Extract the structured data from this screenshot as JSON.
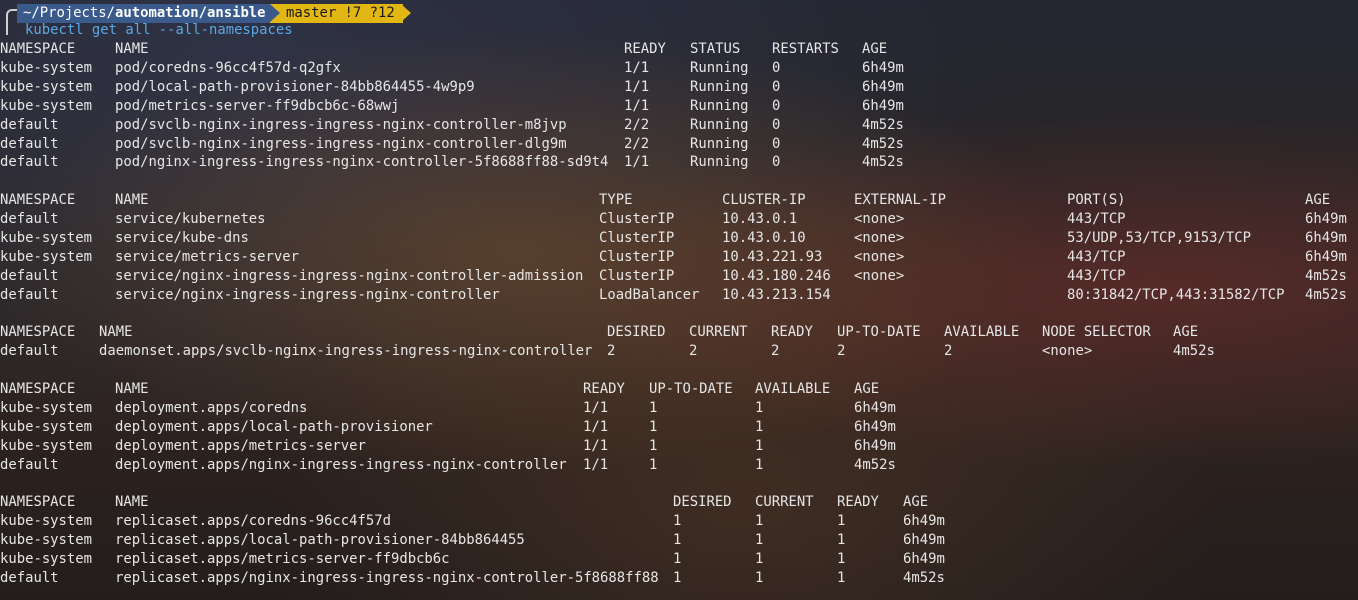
{
  "prompt": {
    "path_prefix": "~/Projects/",
    "path_bold": "automation/ansible",
    "git": "master !7 ?12",
    "command": "kubectl get all --all-namespaces"
  },
  "pods": {
    "headers": [
      "NAMESPACE",
      "NAME",
      "READY",
      "STATUS",
      "RESTARTS",
      "AGE"
    ],
    "rows": [
      [
        "kube-system",
        "pod/coredns-96cc4f57d-q2gfx",
        "1/1",
        "Running",
        "0",
        "6h49m"
      ],
      [
        "kube-system",
        "pod/local-path-provisioner-84bb864455-4w9p9",
        "1/1",
        "Running",
        "0",
        "6h49m"
      ],
      [
        "kube-system",
        "pod/metrics-server-ff9dbcb6c-68wwj",
        "1/1",
        "Running",
        "0",
        "6h49m"
      ],
      [
        "default",
        "pod/svclb-nginx-ingress-ingress-nginx-controller-m8jvp",
        "2/2",
        "Running",
        "0",
        "4m52s"
      ],
      [
        "default",
        "pod/svclb-nginx-ingress-ingress-nginx-controller-dlg9m",
        "2/2",
        "Running",
        "0",
        "4m52s"
      ],
      [
        "default",
        "pod/nginx-ingress-ingress-nginx-controller-5f8688ff88-sd9t4",
        "1/1",
        "Running",
        "0",
        "4m52s"
      ]
    ]
  },
  "services": {
    "headers": [
      "NAMESPACE",
      "NAME",
      "TYPE",
      "CLUSTER-IP",
      "EXTERNAL-IP",
      "PORT(S)",
      "AGE"
    ],
    "rows": [
      [
        "default",
        "service/kubernetes",
        "ClusterIP",
        "10.43.0.1",
        "<none>",
        "443/TCP",
        "6h49m"
      ],
      [
        "kube-system",
        "service/kube-dns",
        "ClusterIP",
        "10.43.0.10",
        "<none>",
        "53/UDP,53/TCP,9153/TCP",
        "6h49m"
      ],
      [
        "kube-system",
        "service/metrics-server",
        "ClusterIP",
        "10.43.221.93",
        "<none>",
        "443/TCP",
        "6h49m"
      ],
      [
        "default",
        "service/nginx-ingress-ingress-nginx-controller-admission",
        "ClusterIP",
        "10.43.180.246",
        "<none>",
        "443/TCP",
        "4m52s"
      ],
      [
        "default",
        "service/nginx-ingress-ingress-nginx-controller",
        "LoadBalancer",
        "10.43.213.154",
        "",
        "80:31842/TCP,443:31582/TCP",
        "4m52s"
      ]
    ]
  },
  "daemonsets": {
    "headers": [
      "NAMESPACE",
      "NAME",
      "DESIRED",
      "CURRENT",
      "READY",
      "UP-TO-DATE",
      "AVAILABLE",
      "NODE SELECTOR",
      "AGE"
    ],
    "rows": [
      [
        "default",
        "daemonset.apps/svclb-nginx-ingress-ingress-nginx-controller",
        "2",
        "2",
        "2",
        "2",
        "2",
        "<none>",
        "4m52s"
      ]
    ]
  },
  "deployments": {
    "headers": [
      "NAMESPACE",
      "NAME",
      "READY",
      "UP-TO-DATE",
      "AVAILABLE",
      "AGE"
    ],
    "rows": [
      [
        "kube-system",
        "deployment.apps/coredns",
        "1/1",
        "1",
        "1",
        "6h49m"
      ],
      [
        "kube-system",
        "deployment.apps/local-path-provisioner",
        "1/1",
        "1",
        "1",
        "6h49m"
      ],
      [
        "kube-system",
        "deployment.apps/metrics-server",
        "1/1",
        "1",
        "1",
        "6h49m"
      ],
      [
        "default",
        "deployment.apps/nginx-ingress-ingress-nginx-controller",
        "1/1",
        "1",
        "1",
        "4m52s"
      ]
    ]
  },
  "replicasets": {
    "headers": [
      "NAMESPACE",
      "NAME",
      "DESIRED",
      "CURRENT",
      "READY",
      "AGE"
    ],
    "rows": [
      [
        "kube-system",
        "replicaset.apps/coredns-96cc4f57d",
        "1",
        "1",
        "1",
        "6h49m"
      ],
      [
        "kube-system",
        "replicaset.apps/local-path-provisioner-84bb864455",
        "1",
        "1",
        "1",
        "6h49m"
      ],
      [
        "kube-system",
        "replicaset.apps/metrics-server-ff9dbcb6c",
        "1",
        "1",
        "1",
        "6h49m"
      ],
      [
        "default",
        "replicaset.apps/nginx-ingress-ingress-nginx-controller-5f8688ff88",
        "1",
        "1",
        "1",
        "4m52s"
      ]
    ]
  }
}
